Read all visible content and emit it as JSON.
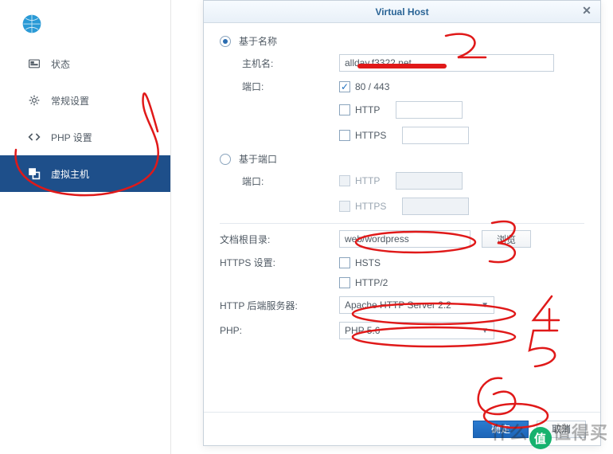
{
  "sidebar": {
    "items": [
      {
        "label": "状态"
      },
      {
        "label": "常规设置"
      },
      {
        "label": "PHP 设置"
      },
      {
        "label": "虚拟主机"
      }
    ]
  },
  "modal": {
    "title": "Virtual Host",
    "name_based": "基于名称",
    "hostname_label": "主机名:",
    "hostname_value": "allday.f3322.net",
    "port_label": "端口:",
    "port_default": "80 / 443",
    "http_label": "HTTP",
    "https_label": "HTTPS",
    "port_based": "基于端口",
    "port_label2": "端口:",
    "docroot_label": "文档根目录:",
    "docroot_value": "web/wordpress",
    "browse": "浏览",
    "https_settings": "HTTPS 设置:",
    "hsts": "HSTS",
    "http2": "HTTP/2",
    "backend_label": "HTTP 后端服务器:",
    "backend_value": "Apache HTTP Server 2.2",
    "php_label": "PHP:",
    "php_value": "PHP 5.6",
    "ok": "确定",
    "cancel": "取消"
  },
  "annotations": [
    "2",
    "3",
    "4",
    "5",
    "6"
  ],
  "watermark": "什么值得买"
}
